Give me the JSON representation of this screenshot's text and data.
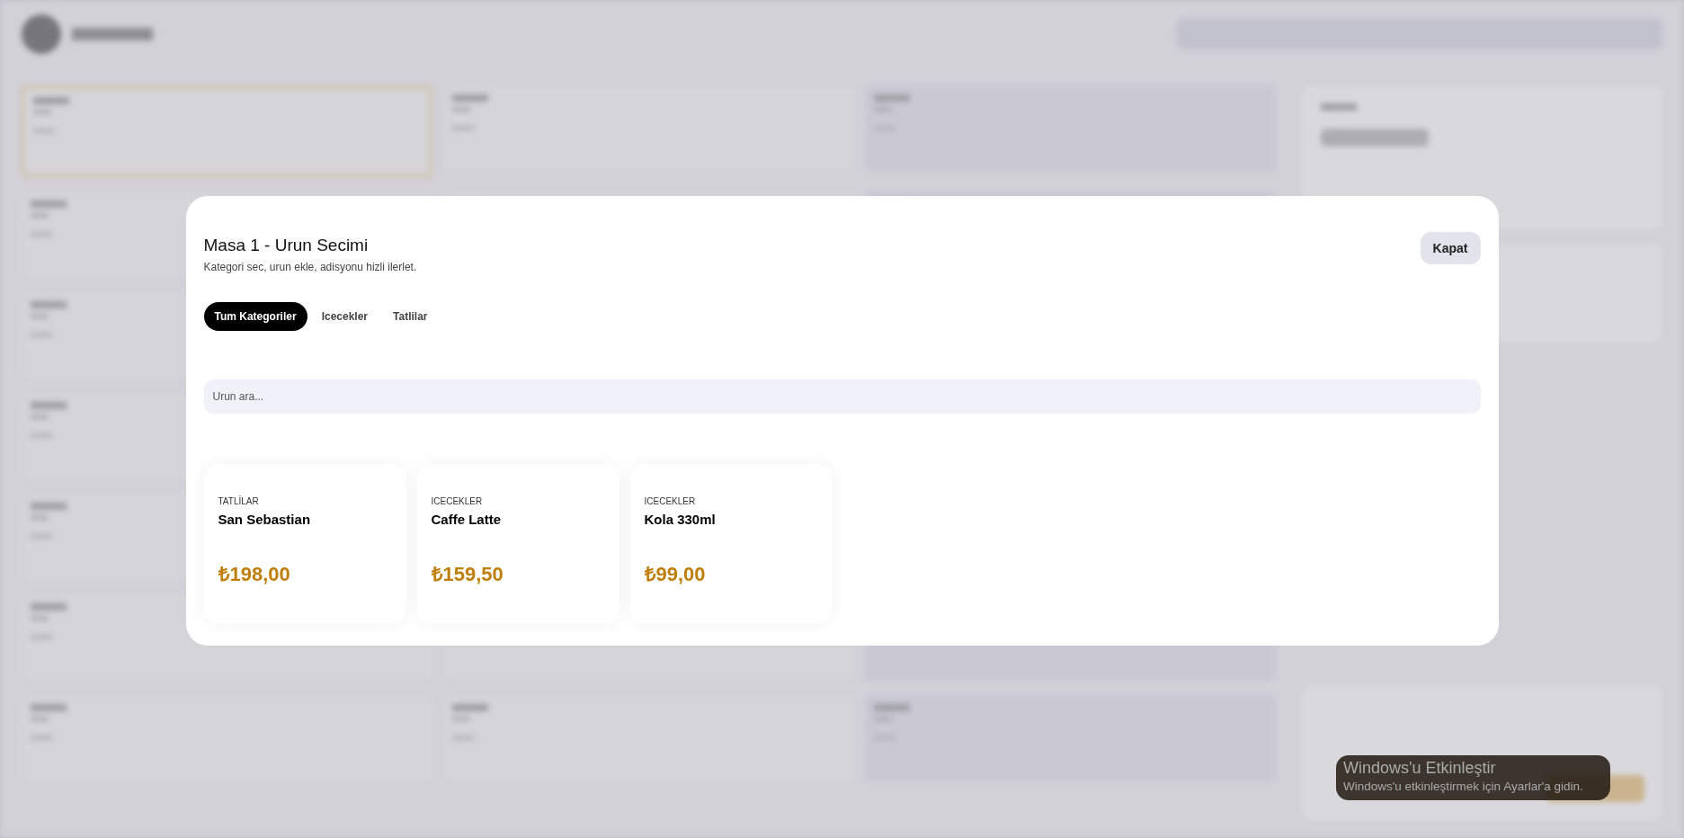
{
  "modal": {
    "title": "Masa 1 - Urun Secimi",
    "subtitle": "Kategori sec, urun ekle, adisyonu hizli ilerlet.",
    "close_button": "Kapat",
    "tabs": [
      {
        "label": "Tum Kategoriler",
        "selected": true
      },
      {
        "label": "Icecekler",
        "selected": false
      },
      {
        "label": "Tatlilar",
        "selected": false
      }
    ],
    "search": {
      "placeholder": "Urun ara..."
    },
    "products": [
      {
        "category": "TATLİLAR",
        "name": "San Sebastian",
        "price": "₺198,00"
      },
      {
        "category": "ICECEKLER",
        "name": "Caffe Latte",
        "price": "₺159,50"
      },
      {
        "category": "ICECEKLER",
        "name": "Kola 330ml",
        "price": "₺99,00"
      }
    ]
  },
  "os_notice": {
    "title": "Windows'u Etkinleştir",
    "text": "Windows'u etkinleştirmek için Ayarlar'a gidin."
  }
}
